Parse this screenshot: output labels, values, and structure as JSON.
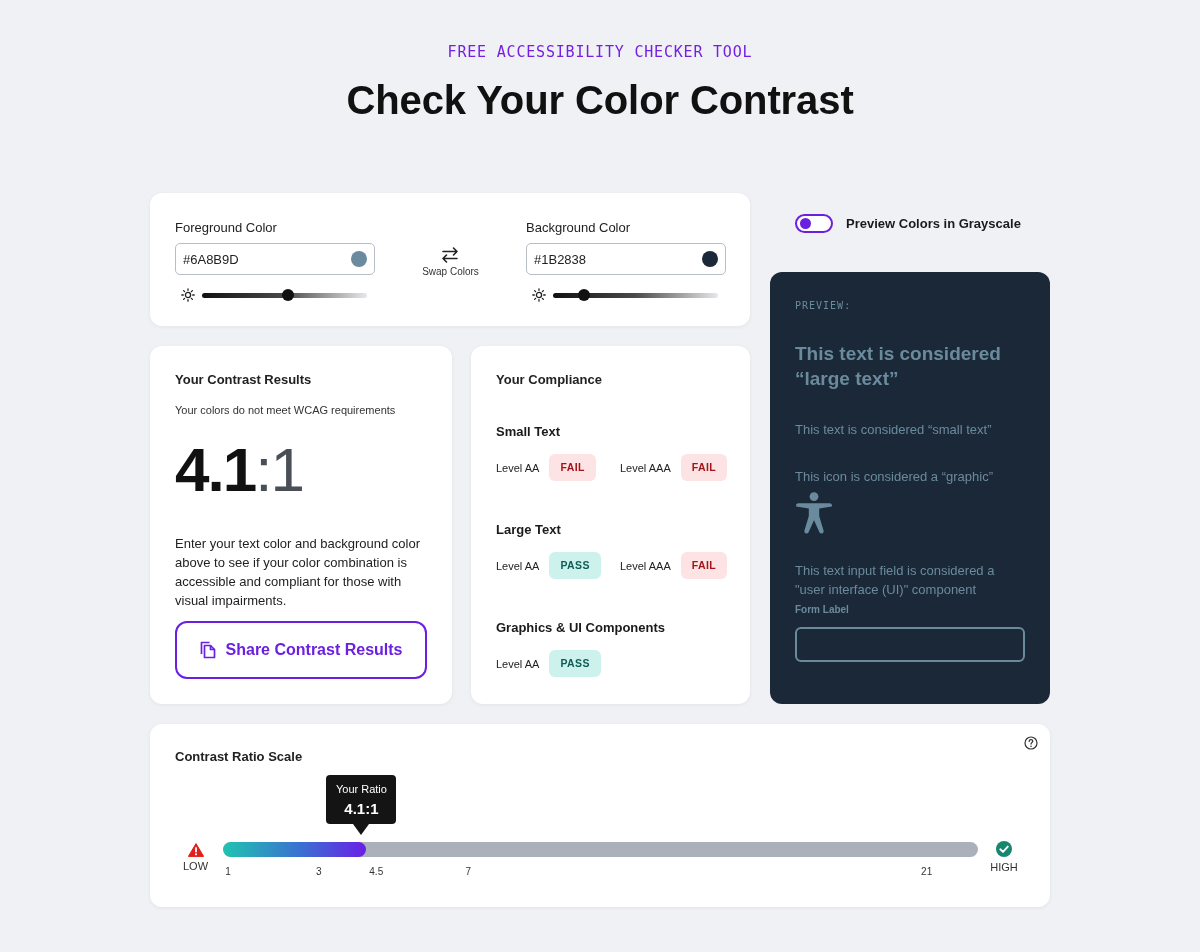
{
  "header": {
    "eyebrow": "FREE ACCESSIBILITY CHECKER TOOL",
    "title": "Check Your Color Contrast"
  },
  "color_picker": {
    "colors": [
      {
        "label": "Foreground Color",
        "value": "#6A8B9D",
        "color": "#6a8b9d",
        "level": 0.52
      },
      {
        "label": "Background Color",
        "value": "#1B2838",
        "color": "#1b2838",
        "level": 0.19
      }
    ],
    "swap_label": "Swap Colors"
  },
  "grayscale_toggle": {
    "label": "Preview Colors in Grayscale",
    "on": false
  },
  "results": {
    "title": "Your Contrast Results",
    "status": "Your colors do not meet WCAG requirements",
    "ratio": "**4.1**:1",
    "description": "Enter your text color and background color above to see if your color combination is accessible and compliant for those with visual impairments.",
    "share_button": "Share Contrast Results"
  },
  "compliance": {
    "title": "Your Compliance",
    "groups": [
      {
        "name": "Small Text",
        "checks": [
          {
            "label": "Level AA",
            "result": "FAIL",
            "passed": false
          },
          {
            "label": "Level AAA",
            "result": "FAIL",
            "passed": false
          }
        ]
      },
      {
        "name": "Large Text",
        "checks": [
          {
            "label": "Level AA",
            "result": "PASS",
            "passed": true
          },
          {
            "label": "Level AAA",
            "result": "FAIL",
            "passed": false
          }
        ]
      },
      {
        "name": "Graphics & UI Components",
        "checks": [
          {
            "label": "Level AA",
            "result": "PASS",
            "passed": true
          }
        ]
      }
    ]
  },
  "preview": {
    "heading": "PREVIEW:",
    "large_text": "This text is considered “large text”",
    "small_text": "This text is considered “small text”",
    "graphic_text": "This icon is considered a “graphic”",
    "ui_text": "This text input field is considered a \"user interface (UI)\" component",
    "form_label": "Form Label"
  },
  "scale": {
    "title": "Contrast Ratio Scale",
    "tooltip_label": "Your Ratio",
    "tooltip_value": "4.1:1",
    "level": 0.19,
    "low_label": "LOW",
    "high_label": "HIGH",
    "ticks": [
      "1",
      "3",
      "4.5",
      "7",
      "21"
    ]
  }
}
